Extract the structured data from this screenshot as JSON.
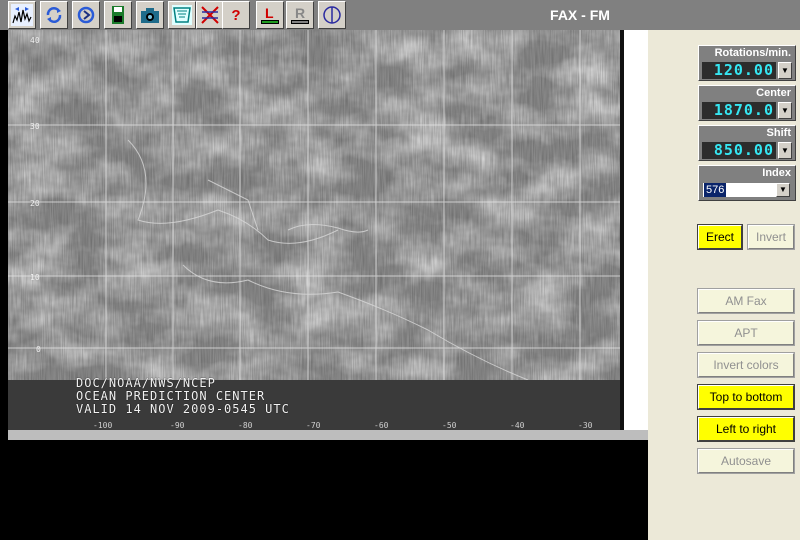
{
  "app": {
    "title": "FAX - FM"
  },
  "toolbar": {
    "buttons": [
      {
        "name": "signal-icon",
        "hint": ""
      },
      {
        "name": "refresh-icon",
        "hint": ""
      },
      {
        "name": "sync-icon",
        "hint": ""
      },
      {
        "name": "save-icon",
        "hint": ""
      },
      {
        "name": "camera-icon",
        "hint": ""
      },
      {
        "name": "filter-icon",
        "hint": ""
      },
      {
        "name": "grid-icon",
        "hint": ""
      },
      {
        "name": "help-icon",
        "label": "?"
      },
      {
        "name": "left-marker-icon",
        "label": "L"
      },
      {
        "name": "right-marker-icon",
        "label": "R"
      },
      {
        "name": "phase-icon",
        "hint": ""
      }
    ]
  },
  "image": {
    "caption": [
      "DOC/NOAA/NWS/NCEP",
      "OCEAN PREDICTION CENTER",
      "VALID 14 NOV 2009-0545 UTC"
    ]
  },
  "panel": {
    "rotations": {
      "label": "Rotations/min.",
      "value": "120.00"
    },
    "center": {
      "label": "Center",
      "value": "1870.0"
    },
    "shift": {
      "label": "Shift",
      "value": "850.00"
    },
    "index": {
      "label": "Index",
      "value": "576"
    },
    "erect_label": "Erect",
    "invert_label": "Invert",
    "am_fax_label": "AM Fax",
    "apt_label": "APT",
    "invert_colors_label": "Invert colors",
    "top_to_bottom_label": "Top to bottom",
    "left_to_right_label": "Left to right",
    "autosave_label": "Autosave"
  },
  "colors": {
    "toolbar_bg": "#808080",
    "panel_bg": "#ece9d8",
    "active_yellow": "#ffff00",
    "lcd_cyan": "#35e6f2"
  },
  "state": {
    "erect": true,
    "invert": false,
    "top_to_bottom": true,
    "left_to_right": true
  }
}
